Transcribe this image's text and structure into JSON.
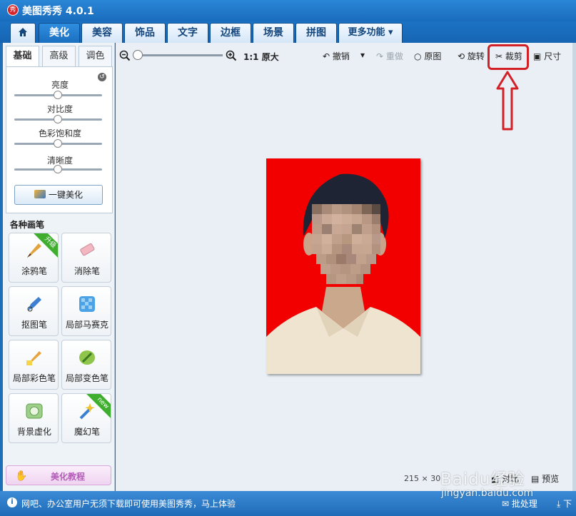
{
  "app": {
    "title": "美图秀秀 4.0.1",
    "logo_text": "秀"
  },
  "nav": {
    "tabs": [
      {
        "label": "",
        "icon": "home-icon"
      },
      {
        "label": "美化",
        "active": true
      },
      {
        "label": "美容"
      },
      {
        "label": "饰品"
      },
      {
        "label": "文字"
      },
      {
        "label": "边框"
      },
      {
        "label": "场景"
      },
      {
        "label": "拼图"
      },
      {
        "label": "更多功能 ▾"
      }
    ]
  },
  "left_panel": {
    "subtabs": [
      {
        "label": "基础",
        "active": true
      },
      {
        "label": "高级"
      },
      {
        "label": "调色"
      }
    ],
    "sliders": [
      {
        "label": "亮度",
        "value": 0.5
      },
      {
        "label": "对比度",
        "value": 0.5
      },
      {
        "label": "色彩饱和度",
        "value": 0.5
      },
      {
        "label": "清晰度",
        "value": 0.5
      }
    ],
    "one_click_button": "一键美化",
    "pens_title": "各种画笔",
    "pens": [
      {
        "label": "涂鸦笔",
        "icon": "brush-icon",
        "badge": "升级"
      },
      {
        "label": "消除笔",
        "icon": "eraser-icon",
        "badge": ""
      },
      {
        "label": "抠图笔",
        "icon": "cutout-pen-icon",
        "badge": ""
      },
      {
        "label": "局部马赛克",
        "icon": "mosaic-icon",
        "badge": ""
      },
      {
        "label": "局部彩色笔",
        "icon": "color-brush-icon",
        "badge": ""
      },
      {
        "label": "局部变色笔",
        "icon": "color-change-icon",
        "badge": ""
      },
      {
        "label": "背景虚化",
        "icon": "blur-background-icon",
        "badge": ""
      },
      {
        "label": "魔幻笔",
        "icon": "magic-pen-icon",
        "badge": "new"
      }
    ],
    "tutorial_button": "美化教程"
  },
  "toolbar": {
    "original_size": "1:1 原大",
    "undo": "撤销",
    "redo": "重做",
    "original": "原图",
    "rotate": "旋转",
    "crop": "裁剪",
    "size": "尺寸"
  },
  "canvas": {
    "image_size": "215 × 30",
    "compare": "对比",
    "preview": "预览"
  },
  "status": {
    "message": "网吧、办公室用户无须下载即可使用美图秀秀，马上体验",
    "batch": "批处理",
    "download": "下"
  },
  "watermark": {
    "text": "Baidu经验",
    "url": "jingyan.baidu.com"
  },
  "colors": {
    "title_bar": "#1a6cbd",
    "photo_background": "#f20000",
    "annotation": "#d32027"
  }
}
